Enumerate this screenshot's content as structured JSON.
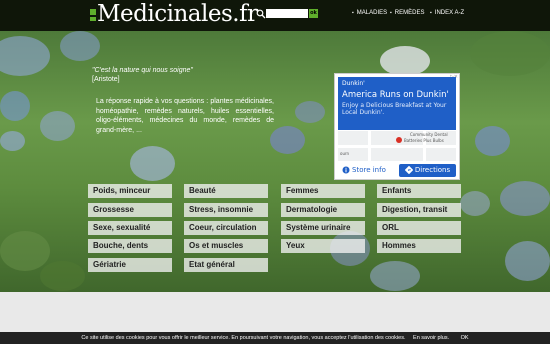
{
  "header": {
    "logo": "Medicinales.fr",
    "search": {
      "placeholder": "",
      "button": "ok"
    },
    "nav": [
      "MALADIES",
      "REMÈDES",
      "INDEX A-Z"
    ]
  },
  "hero": {
    "quote": "\"C'est la nature qui nous soigne\"",
    "author": "[Aristote]",
    "intro": "La réponse rapide à vos questions : plantes médicinales, homéopathie, remèdes naturels, huiles essentielles, oligo-éléments, médecines du monde, remèdes de grand-mère, ..."
  },
  "ad": {
    "brand": "Dunkin'",
    "title": "America Runs on Dunkin'",
    "description": "Enjoy a Delicious Breakfast at Your Local Dunkin'.",
    "map_labels": [
      "Batteries Plus Bulbs",
      "Community Dental",
      "ourn"
    ],
    "store_info": "Store info",
    "directions": "Directions"
  },
  "categories": [
    [
      "Poids, minceur",
      "Beauté",
      "Femmes",
      "Enfants"
    ],
    [
      "Grossesse",
      "Stress, insomnie",
      "Dermatologie",
      "Digestion, transit"
    ],
    [
      "Sexe, sexualité",
      "Coeur, circulation",
      "Système urinaire",
      "ORL"
    ],
    [
      "Bouche, dents",
      "Os et muscles",
      "Yeux",
      "Hommes"
    ],
    [
      "Gériatrie",
      "Etat général"
    ]
  ],
  "cookie_bar": {
    "text": "Ce site utilise des cookies pour vous offrir le meilleur service. En poursuivant votre navigation, vous acceptez l'utilisation des cookies.",
    "more": "En savoir plus.",
    "ok": "OK"
  }
}
